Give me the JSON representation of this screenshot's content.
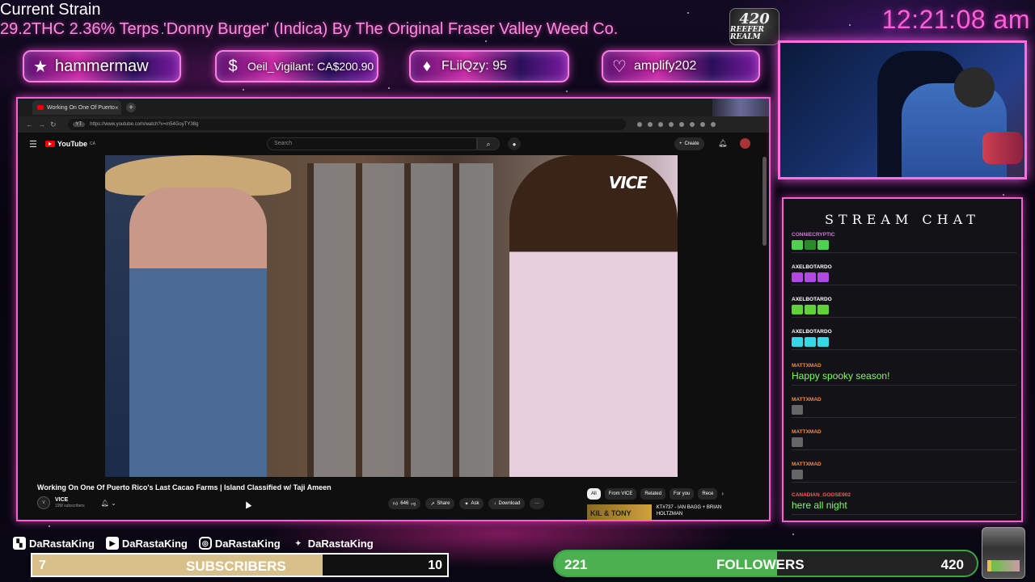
{
  "overlay": {
    "strain_heading": "Current Strain",
    "strain_text": "29.2THC 2.36% Terps 'Donny Burger' (Indica) By The Original Fraser Valley Weed Co.",
    "clock": "12:21:08 am",
    "logo_top": "420",
    "logo_bottom": "REEFER REALM"
  },
  "alerts": [
    {
      "icon": "star-icon",
      "glyph": "★",
      "label": "hammermaw"
    },
    {
      "icon": "dollar-icon",
      "glyph": "$",
      "label": "Oeil_Vigilant: CA$200.90"
    },
    {
      "icon": "diamond-icon",
      "glyph": "♦",
      "label": "FLiiQzy: 95"
    },
    {
      "icon": "heart-icon",
      "glyph": "♡",
      "label": "amplify202"
    }
  ],
  "browser": {
    "tab_title": "Working On One Of Puerto",
    "tab_close": "×",
    "new_tab": "+",
    "url": "https://www.youtube.com/watch?v=m54GoyTY38g",
    "url_pill": "YT"
  },
  "youtube": {
    "brand": "YouTube",
    "region": "CA",
    "search_placeholder": "Search",
    "create_label": "Create",
    "video_watermark": "VICE",
    "video_title": "Working On One Of Puerto Rico's Last Cacao Farms | Island Classified w/ Taji Ameen",
    "channel_name": "VICE",
    "channel_subs": "19M subscribers",
    "like_count": "646",
    "share_label": "Share",
    "ask_label": "Ask",
    "download_label": "Download",
    "more_label": "···",
    "chips": [
      "All",
      "From VICE",
      "Related",
      "For you",
      "Rece"
    ],
    "next_thumb": "KIL & TONY",
    "next_title": "KT#737 - IAN BAGG + BRIAN HOLTZMAN"
  },
  "chat": {
    "title": "STREAM CHAT",
    "messages": [
      {
        "user": "conniecryptic",
        "color": "#d07ad8",
        "text": "",
        "emotes": [
          "#4fd14f",
          "#2a8a2a",
          "#4fd14f"
        ]
      },
      {
        "user": "AXELBOTARDO",
        "color": "#ffffff",
        "text": "",
        "emotes": [
          "#b04adf",
          "#b04adf",
          "#b04adf"
        ]
      },
      {
        "user": "AXELBOTARDO",
        "color": "#ffffff",
        "text": "",
        "emotes": [
          "#5fd13a",
          "#5fd13a",
          "#5fd13a"
        ]
      },
      {
        "user": "AXELBOTARDO",
        "color": "#ffffff",
        "text": "",
        "emotes": [
          "#39d6e8",
          "#39d6e8",
          "#39d6e8"
        ]
      },
      {
        "user": "mattxmad",
        "color": "#ff8a2a",
        "text": "Happy spooky season!",
        "emotes": []
      },
      {
        "user": "mattxmad",
        "color": "#ff8a2a",
        "text": "",
        "emotes": [
          "#666666"
        ]
      },
      {
        "user": "mattxmad",
        "color": "#ff8a2a",
        "text": "",
        "emotes": [
          "#666666"
        ]
      },
      {
        "user": "mattxmad",
        "color": "#ff8a2a",
        "text": "",
        "emotes": [
          "#666666"
        ]
      },
      {
        "user": "CANADIAN_GOOSE902",
        "color": "#ff5a5a",
        "text": "here all night",
        "emotes": []
      }
    ]
  },
  "socials": [
    {
      "icon": "twitch-icon",
      "glyph": "▚",
      "handle": "DaRastaKing"
    },
    {
      "icon": "youtube-icon",
      "glyph": "▶",
      "handle": "DaRastaKing"
    },
    {
      "icon": "instagram-icon",
      "glyph": "◎",
      "handle": "DaRastaKing"
    },
    {
      "icon": "twitter-icon",
      "glyph": "✦",
      "handle": "DaRastaKing"
    }
  ],
  "goals": {
    "subs_current": "7",
    "subs_label": "SUBSCRIBERS",
    "subs_goal": "10",
    "subs_fraction": 0.7,
    "followers_current": "221",
    "followers_label": "FOLLOWERS",
    "followers_goal": "420",
    "followers_fraction": 0.526
  },
  "colors": {
    "accent_pink": "#ff5fd8",
    "chat_text_green": "#7dff5a",
    "followers_green": "#4caf50",
    "subs_tan": "#d8c08a"
  }
}
